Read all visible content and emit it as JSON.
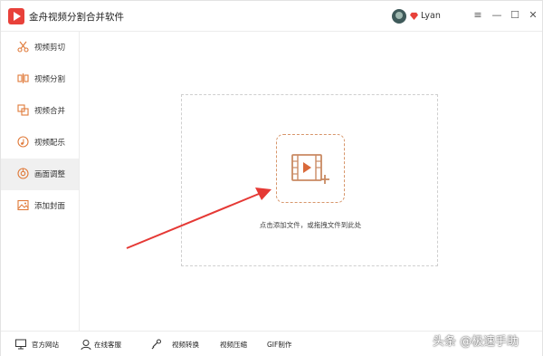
{
  "app": {
    "title": "金舟视频分割合并软件",
    "username": "Lyan"
  },
  "window_controls": {
    "menu": "≡",
    "minimize": "—",
    "maximize": "☐",
    "close": "✕"
  },
  "sidebar": {
    "items": [
      {
        "label": "视频剪切",
        "icon": "scissors-icon",
        "active": false
      },
      {
        "label": "视频分割",
        "icon": "split-icon",
        "active": false
      },
      {
        "label": "视频合并",
        "icon": "merge-icon",
        "active": false
      },
      {
        "label": "视频配乐",
        "icon": "music-icon",
        "active": false
      },
      {
        "label": "画面调整",
        "icon": "adjust-icon",
        "active": true
      },
      {
        "label": "添加封面",
        "icon": "image-icon",
        "active": false
      }
    ]
  },
  "main": {
    "hint": "点击添加文件，或拖拽文件到此处"
  },
  "footer": {
    "items": [
      {
        "label": "官方网站",
        "icon": "monitor-icon"
      },
      {
        "label": "在线客服",
        "icon": "headset-icon"
      },
      {
        "label": "视频转换",
        "icon": "convert-icon"
      },
      {
        "label": "视频压缩",
        "icon": ""
      },
      {
        "label": "GIF制作",
        "icon": ""
      }
    ]
  },
  "watermark": "头条 @极速手助",
  "colors": {
    "accent": "#e8413a",
    "dashed_accent": "#d7966b",
    "arrow": "#e53935"
  }
}
